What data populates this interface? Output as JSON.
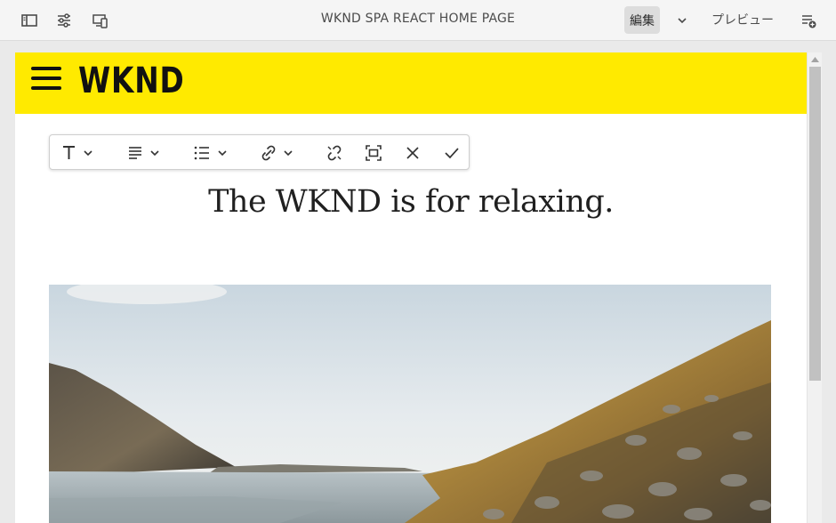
{
  "topbar": {
    "title": "WKND SPA REACT HOME PAGE",
    "mode_label": "編集",
    "preview_label": "プレビュー",
    "icons": [
      "side-panel-icon",
      "page-properties-icon",
      "emulator-icon",
      "chevron-down-icon",
      "annotations-icon"
    ]
  },
  "site": {
    "logo": "WKND",
    "brand_color": "#ffea00",
    "hero_title": "The WKND is for relaxing."
  },
  "rte_toolbar": {
    "buttons": [
      "paragraph-format-icon",
      "justify-icon",
      "list-icon",
      "link-icon",
      "unlink-icon",
      "fullscreen-icon",
      "cancel-icon",
      "save-check-icon"
    ]
  },
  "image": {
    "description_icon": "lake-mountains-image"
  }
}
